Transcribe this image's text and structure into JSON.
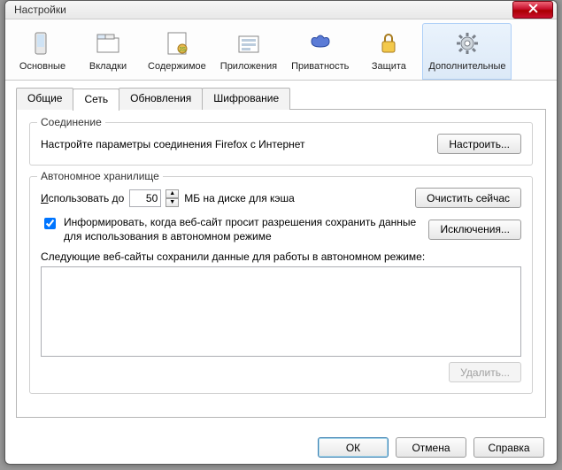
{
  "window": {
    "title": "Настройки"
  },
  "toolbar": {
    "items": [
      {
        "label": "Основные"
      },
      {
        "label": "Вкладки"
      },
      {
        "label": "Содержимое"
      },
      {
        "label": "Приложения"
      },
      {
        "label": "Приватность"
      },
      {
        "label": "Защита"
      },
      {
        "label": "Дополнительные"
      }
    ]
  },
  "tabs": {
    "items": [
      {
        "label": "Общие"
      },
      {
        "label": "Сеть"
      },
      {
        "label": "Обновления"
      },
      {
        "label": "Шифрование"
      }
    ]
  },
  "connection": {
    "group_title": "Соединение",
    "desc": "Настройте параметры соединения Firefox с Интернет",
    "configure_btn": "Настроить..."
  },
  "offline": {
    "group_title": "Автономное хранилище",
    "use_up_to_prefix": "И",
    "use_up_to_rest": "спользовать до",
    "cache_value": "50",
    "cache_suffix": "МБ на диске для кэша",
    "clear_btn": "Очистить сейчас",
    "inform_label": "Информировать, когда веб-сайт просит разрешения сохранить данные для использования в автономном режиме",
    "exceptions_btn": "Исключения...",
    "list_label": "Следующие веб-сайты сохранили данные для работы в автономном режиме:",
    "remove_btn": "Удалить..."
  },
  "footer": {
    "ok": "ОК",
    "cancel": "Отмена",
    "help": "Справка"
  }
}
